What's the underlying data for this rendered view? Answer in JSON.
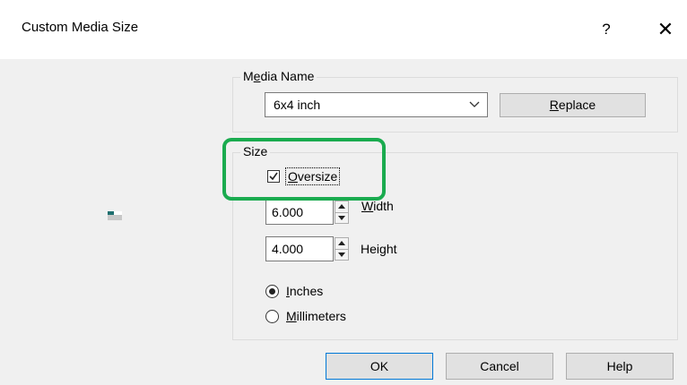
{
  "window": {
    "title": "Custom Media Size",
    "help_glyph": "?",
    "close_glyph": "✕"
  },
  "media_name_group": {
    "label_pre": "M",
    "label_mnemonic": "e",
    "label_post": "dia Name",
    "selected_value": "6x4 inch",
    "replace_button": {
      "mnemonic": "R",
      "rest": "eplace"
    }
  },
  "size_group": {
    "label": "Size",
    "oversize": {
      "checked": true,
      "mnemonic": "O",
      "rest": "versize"
    },
    "width": {
      "value": "6.000",
      "label_mnemonic": "W",
      "label_rest": "idth"
    },
    "height": {
      "value": "4.000",
      "label_pre": "Hei",
      "label_mnemonic": "g",
      "label_post": "ht"
    },
    "units": {
      "inches": {
        "mnemonic": "I",
        "rest": "nches",
        "selected": true
      },
      "millimeters": {
        "mnemonic": "M",
        "rest": "illimeters",
        "selected": false
      }
    }
  },
  "buttons": {
    "ok": "OK",
    "cancel": "Cancel",
    "help": "Help"
  },
  "colors": {
    "highlight": "#1aab4f",
    "default_button_border": "#0078d7"
  }
}
